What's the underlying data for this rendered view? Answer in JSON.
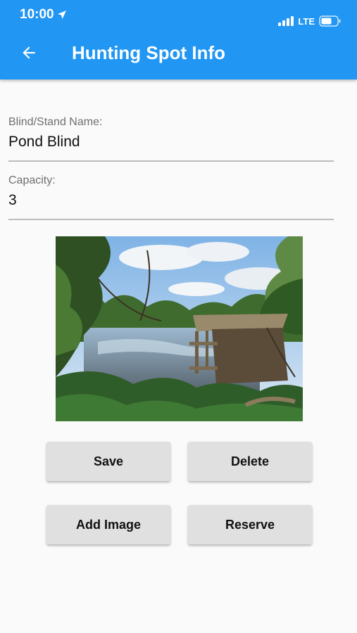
{
  "status_bar": {
    "time": "10:00",
    "network": "LTE",
    "location_icon": "location-arrow-icon",
    "signal_icon": "signal-bars-icon",
    "battery_icon": "battery-icon"
  },
  "appbar": {
    "title": "Hunting Spot Info",
    "back_icon": "arrow-back-icon",
    "color": "#2196f3"
  },
  "form": {
    "name_label": "Blind/Stand Name:",
    "name_value": "Pond Blind",
    "capacity_label": "Capacity:",
    "capacity_value": "3"
  },
  "image": {
    "subject": "blind-photo"
  },
  "buttons": {
    "save": "Save",
    "delete": "Delete",
    "add_image": "Add Image",
    "reserve": "Reserve"
  }
}
